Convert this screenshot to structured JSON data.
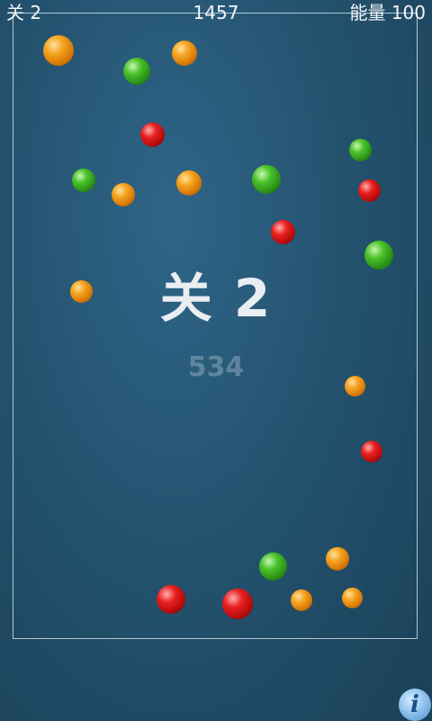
{
  "hud": {
    "level": "关 2",
    "score": "1457",
    "energy": "能量 100"
  },
  "banner": {
    "level_text": "关 2",
    "countdown": "534"
  },
  "info_button": {
    "label": "i"
  },
  "colors": {
    "orange": "#f7a623",
    "green": "#4ac22a",
    "red": "#e82020",
    "info": "#8fc3ee"
  },
  "balls": [
    {
      "color": "orange"
    },
    {
      "color": "green"
    },
    {
      "color": "orange"
    },
    {
      "color": "red"
    },
    {
      "color": "green"
    },
    {
      "color": "orange"
    },
    {
      "color": "orange"
    },
    {
      "color": "green"
    },
    {
      "color": "green"
    },
    {
      "color": "red"
    },
    {
      "color": "red"
    },
    {
      "color": "green"
    },
    {
      "color": "orange"
    },
    {
      "color": "orange"
    },
    {
      "color": "red"
    },
    {
      "color": "green"
    },
    {
      "color": "orange"
    },
    {
      "color": "red"
    },
    {
      "color": "red"
    },
    {
      "color": "orange"
    },
    {
      "color": "orange"
    }
  ]
}
